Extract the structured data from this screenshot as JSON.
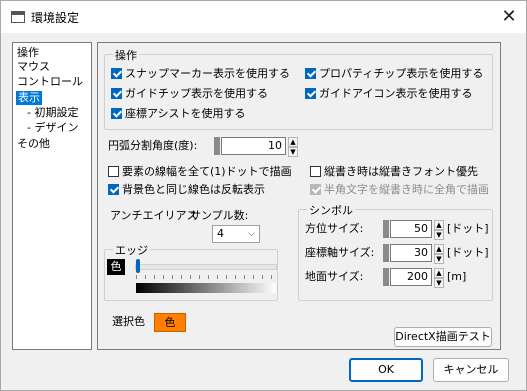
{
  "window": {
    "title": "環境設定",
    "close_glyph": "✕"
  },
  "sidebar": {
    "items": [
      {
        "label": "操作"
      },
      {
        "label": "マウス"
      },
      {
        "label": "コントロール"
      },
      {
        "label": "表示"
      },
      {
        "label": "- 初期設定"
      },
      {
        "label": "- デザイン"
      },
      {
        "label": "その他"
      }
    ],
    "selected": "表示"
  },
  "operation_group": {
    "title": "操作",
    "checkboxes": [
      {
        "label": "スナップマーカー表示を使用する",
        "checked": true
      },
      {
        "label": "プロパティチップ表示を使用する",
        "checked": true
      },
      {
        "label": "ガイドチップ表示を使用する",
        "checked": true
      },
      {
        "label": "ガイドアイコン表示を使用する",
        "checked": true
      },
      {
        "label": "座標アシストを使用する",
        "checked": true
      }
    ]
  },
  "arc_division": {
    "label": "円弧分割角度(度):",
    "value": "10"
  },
  "options": [
    {
      "label": "要素の線幅を全て(1)ドットで描画",
      "checked": false,
      "enabled": true
    },
    {
      "label": "縦書き時は縦書きフォント優先",
      "checked": false,
      "enabled": true
    },
    {
      "label": "背景色と同じ線色は反転表示",
      "checked": true,
      "enabled": true
    },
    {
      "label": "半角文字を縦書き時に全角で描画",
      "checked": true,
      "enabled": false
    }
  ],
  "antialias": {
    "label": "アンチエイリアス",
    "sample_label": "サンプル数:",
    "sample_value": "4"
  },
  "edge_group": {
    "title": "エッジ",
    "color_chip_label": "色",
    "slider_value": 0,
    "edge_color": "#000000"
  },
  "symbol_group": {
    "title": "シンボル",
    "fields": [
      {
        "label": "方位サイズ:",
        "value": "50",
        "unit": "[ドット]"
      },
      {
        "label": "座標軸サイズ:",
        "value": "30",
        "unit": "[ドット]"
      },
      {
        "label": "地面サイズ:",
        "value": "200",
        "unit": "[m]"
      }
    ]
  },
  "selection_color": {
    "label": "選択色",
    "chip_label": "色",
    "color": "#ff7f00"
  },
  "buttons": {
    "directx_test": "DirectX描画テスト",
    "ok": "OK",
    "cancel": "キャンセル"
  },
  "colors": {
    "accent": "#0067c0",
    "selection_highlight": "#0078d7"
  }
}
